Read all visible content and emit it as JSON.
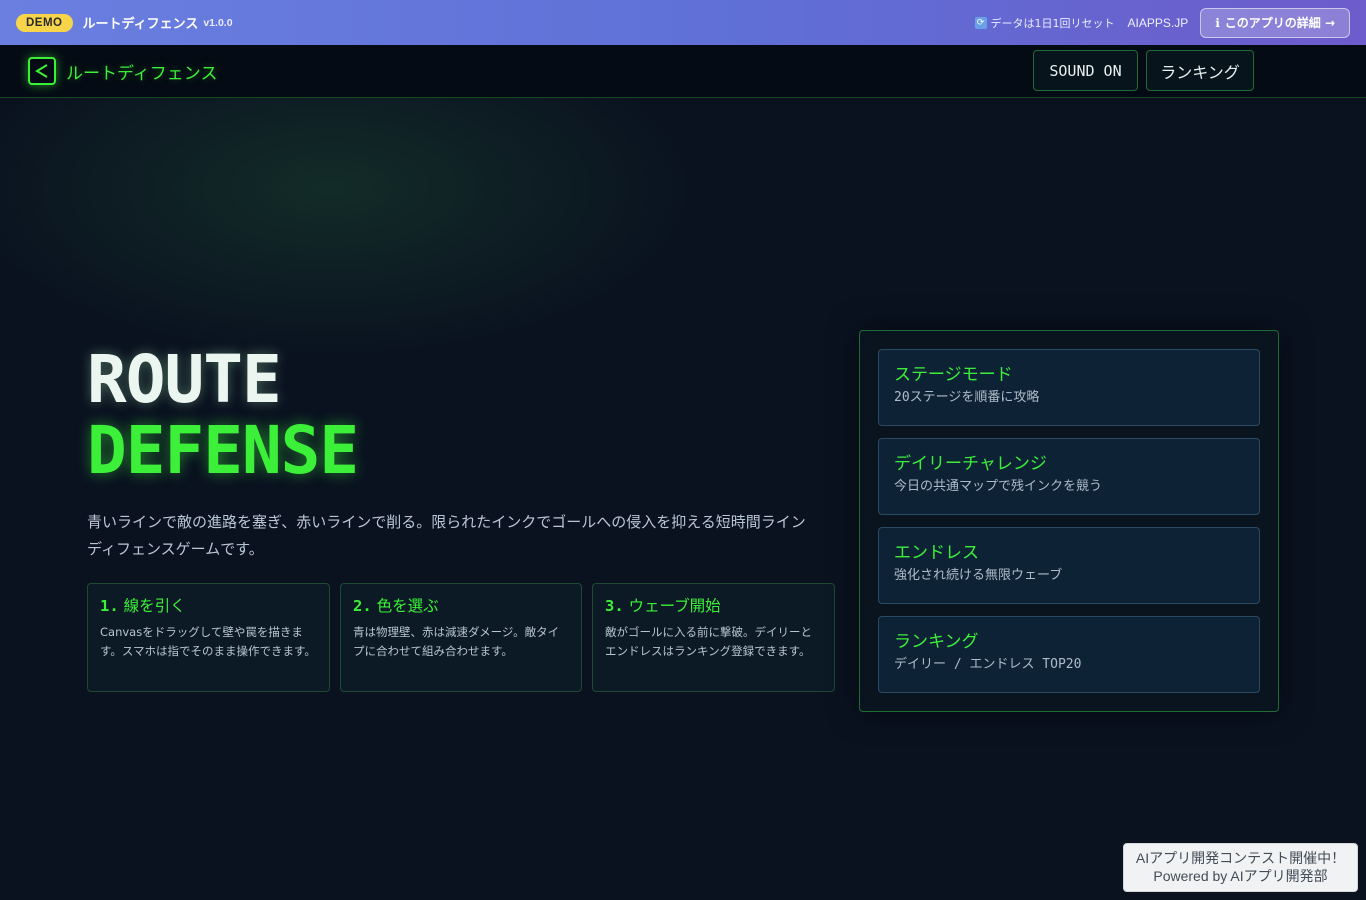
{
  "demo_bar": {
    "badge": "DEMO",
    "app_name": "ルートディフェンス",
    "version": "v1.0.0",
    "reset_icon": "🔄",
    "reset_note": "データは1日1回リセット",
    "site": "AIAPPS.JP",
    "detail_icon": "ℹ",
    "detail_button": "このアプリの詳細 →"
  },
  "header": {
    "title": "ルートディフェンス",
    "sound_button": "SOUND ON",
    "ranking_button": "ランキング"
  },
  "hero": {
    "title_line1": "ROUTE",
    "title_line2": "DEFENSE",
    "description": "青いラインで敵の進路を塞ぎ、赤いラインで削る。限られたインクでゴールへの侵入を抑える短時間ラインディフェンスゲームです。"
  },
  "steps": [
    {
      "num": "1.",
      "title": "線を引く",
      "desc": "Canvasをドラッグして壁や罠を描きます。スマホは指でそのまま操作できます。"
    },
    {
      "num": "2.",
      "title": "色を選ぶ",
      "desc": "青は物理壁、赤は減速ダメージ。敵タイプに合わせて組み合わせます。"
    },
    {
      "num": "3.",
      "title": "ウェーブ開始",
      "desc": "敵がゴールに入る前に撃破。デイリーとエンドレスはランキング登録できます。"
    }
  ],
  "modes": [
    {
      "title": "ステージモード",
      "sub": "20ステージを順番に攻略"
    },
    {
      "title": "デイリーチャレンジ",
      "sub": "今日の共通マップで残インクを競う"
    },
    {
      "title": "エンドレス",
      "sub": "強化され続ける無限ウェーブ"
    },
    {
      "title": "ランキング",
      "sub": "デイリー / エンドレス TOP20"
    }
  ],
  "contest": {
    "line1": "AIアプリ開発コンテスト開催中！",
    "line2": "Powered by AIアプリ開発部"
  },
  "colors": {
    "accent": "#3cf03a",
    "background": "#0a1220",
    "demo_bar": "#6a7fe0"
  }
}
